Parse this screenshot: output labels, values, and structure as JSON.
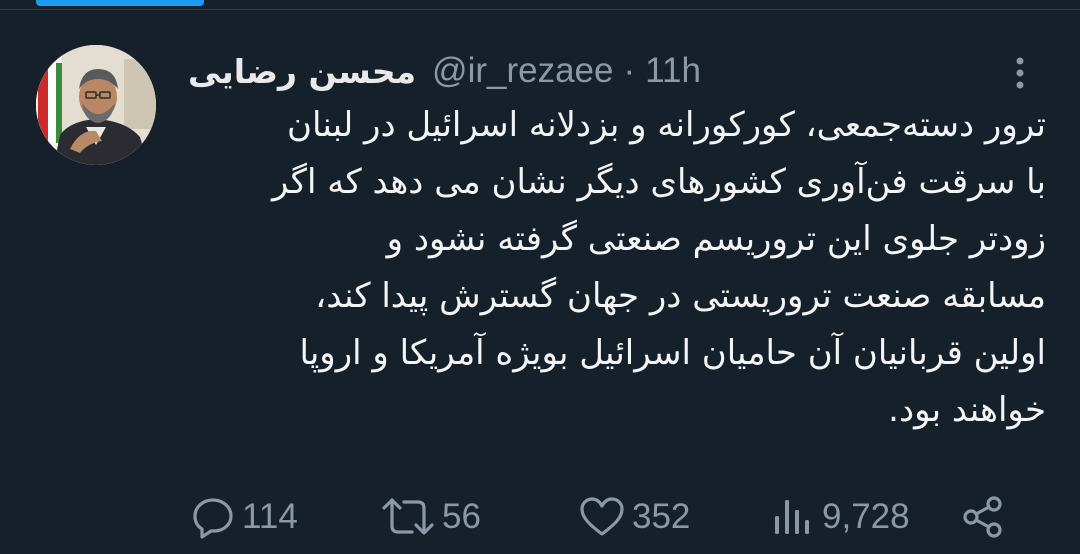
{
  "tweet": {
    "author": {
      "display_name": "محسن رضایی",
      "handle": "@ir_rezaee",
      "avatar_icon": "profile-photo"
    },
    "separator": "·",
    "time": "11h",
    "text_lines": [
      "ترور دسته‌جمعی، کورکورانه و بزدلانه اسرائیل در لبنان",
      "با سرقت فن‌آوری کشورهای دیگر نشان می دهد که اگر",
      "زودتر جلوی این تروریسم صنعتی گرفته نشود و",
      "مسابقه صنعت تروریستی در جهان گسترش پیدا کند،",
      "اولین قربانیان آن حامیان اسرائیل بویژه آمریکا و اروپا",
      "خواهند بود."
    ],
    "actions": {
      "replies": "114",
      "retweets": "56",
      "likes": "352",
      "views": "9,728"
    }
  },
  "colors": {
    "background": "#15202b",
    "text": "#e7e9ea",
    "muted": "#8b98a5",
    "accent": "#1d9bf0"
  }
}
